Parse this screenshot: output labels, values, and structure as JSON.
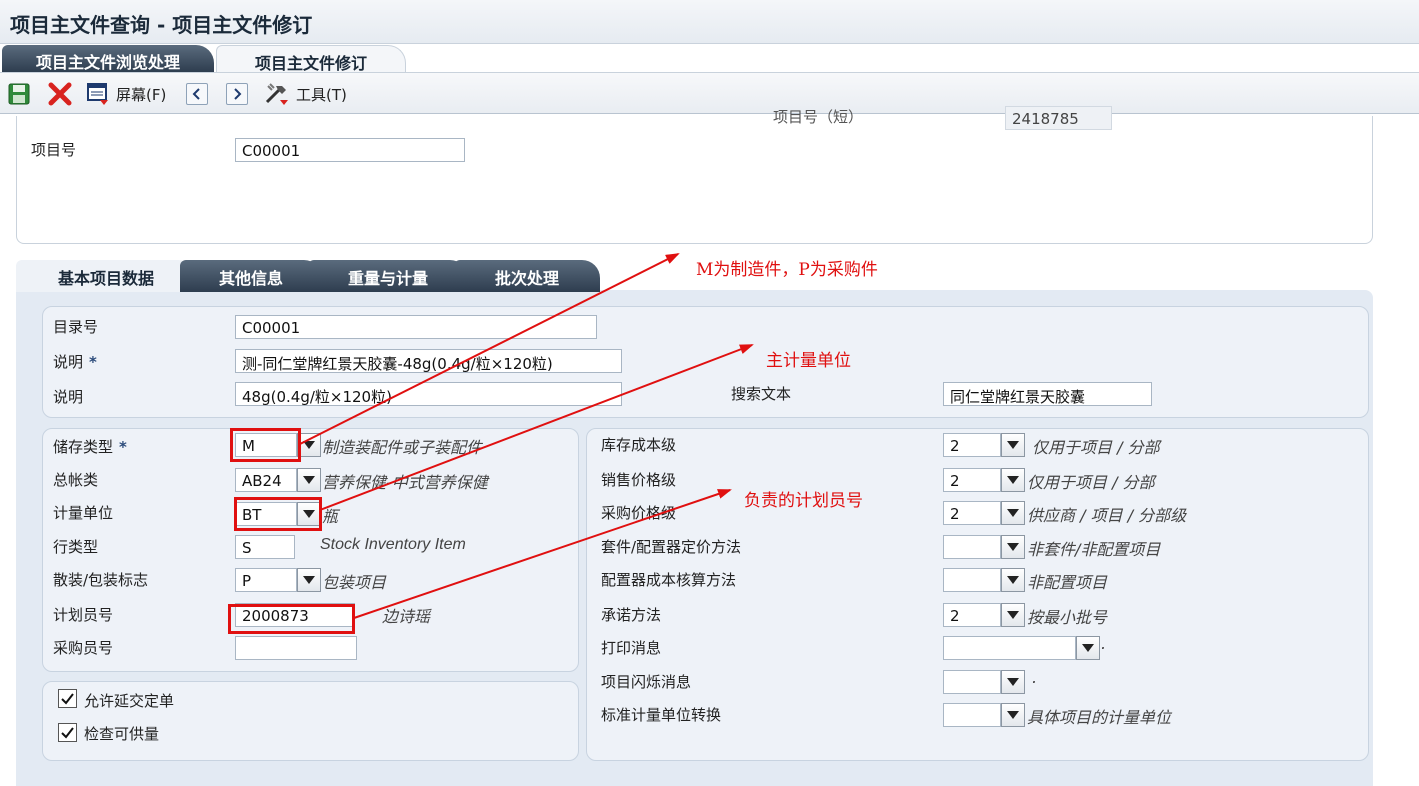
{
  "window": {
    "title": "项目主文件查询 - 项目主文件修订"
  },
  "page_tabs": [
    "项目主文件浏览处理",
    "项目主文件修订"
  ],
  "toolbar": {
    "screen_label": "屏幕(F)",
    "tools_label": "工具(T)",
    "icons": [
      "save-icon",
      "cancel-icon",
      "screen-icon",
      "previous-icon",
      "next-icon",
      "tools-icon"
    ]
  },
  "header": {
    "item_number_label": "项目号",
    "item_number_value": "C00001",
    "short_item_label": "项目号（短）",
    "short_item_value": "2418785"
  },
  "form_tabs": [
    "基本项目数据",
    "其他信息",
    "重量与计量",
    "批次处理"
  ],
  "basic": {
    "catalog_label": "目录号",
    "catalog_value": "C00001",
    "desc1_label": "说明",
    "desc1_value": "测-同仁堂牌红景天胶囊-48g(0.4g/粒×120粒)",
    "desc2_label": "说明",
    "desc2_value": "48g(0.4g/粒×120粒)",
    "search_text_label": "搜索文本",
    "search_text_value": "同仁堂牌红景天胶囊",
    "required_marker": "*"
  },
  "left_fields": {
    "stocking_type_label": "储存类型",
    "stocking_type_value": "M",
    "stocking_type_desc": "制造装配件或子装配件",
    "gl_class_label": "总帐类",
    "gl_class_value": "AB24",
    "gl_class_desc": "营养保健-中式营养保健",
    "uom_label": "计量单位",
    "uom_value": "BT",
    "uom_desc": "瓶",
    "line_type_label": "行类型",
    "line_type_value": "S",
    "line_type_desc": "Stock Inventory Item",
    "bulk_label": "散装/包装标志",
    "bulk_value": "P",
    "bulk_desc": "包装项目",
    "planner_label": "计划员号",
    "planner_value": "2000873",
    "planner_desc": "边诗瑶",
    "buyer_label": "采购员号",
    "buyer_value": ""
  },
  "checks": {
    "backorder_label": "允许延交定单",
    "backorder_checked": true,
    "availability_label": "检查可供量",
    "availability_checked": true
  },
  "right_fields": {
    "inv_cost_label": "库存成本级",
    "inv_cost_value": "2",
    "inv_cost_desc": "仅用于项目 / 分部",
    "sales_price_label": "销售价格级",
    "sales_price_value": "2",
    "sales_price_desc": "仅用于项目 / 分部",
    "purchase_price_label": "采购价格级",
    "purchase_price_value": "2",
    "purchase_price_desc": "供应商 / 项目 / 分部级",
    "kit_pricing_label": "套件/配置器定价方法",
    "kit_pricing_value": "",
    "kit_pricing_desc": "非套件/非配置项目",
    "config_cost_label": "配置器成本核算方法",
    "config_cost_value": "",
    "config_cost_desc": "非配置项目",
    "commit_label": "承诺方法",
    "commit_value": "2",
    "commit_desc": "按最小批号",
    "print_msg_label": "打印消息",
    "print_msg_value": "",
    "print_msg_desc": ".",
    "flash_msg_label": "项目闪烁消息",
    "flash_msg_value": "",
    "flash_msg_desc": ".",
    "std_uom_label": "标准计量单位转换",
    "std_uom_value": "",
    "std_uom_desc": "具体项目的计量单位"
  },
  "annotations": {
    "stocking": "M为制造件，P为采购件",
    "uom": "主计量单位",
    "planner": "负责的计划员号"
  },
  "colors": {
    "annotation": "#e01010",
    "tab_dark": "#2e3d4f",
    "panel": "#e3eaf3"
  }
}
